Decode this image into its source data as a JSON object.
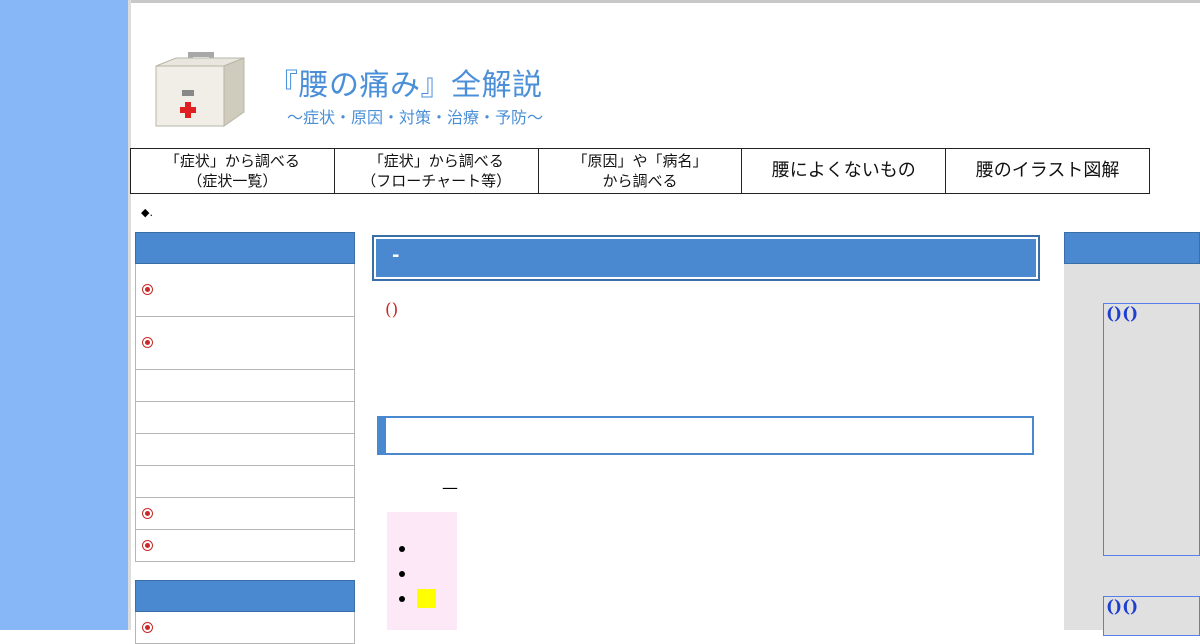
{
  "header": {
    "title": "『腰の痛み』全解説",
    "subtitle": "～症状・原因・対策・治療・予防～",
    "logo_icon": "first-aid-box-icon"
  },
  "nav": {
    "items": [
      {
        "line1": "「症状」から調べる",
        "line2": "（症状一覧）"
      },
      {
        "line1": "「症状」から調べる",
        "line2": "（フローチャート等）"
      },
      {
        "line1": "「原因」や「病名」",
        "line2": "から調べる"
      },
      {
        "line1": "腰によくないもの",
        "line2": ""
      },
      {
        "line1": "腰のイラスト図解",
        "line2": ""
      }
    ]
  },
  "breadcrumb": {
    "marker": "◆."
  },
  "main": {
    "title_text": "-",
    "red_text": "()",
    "dash_text": "—"
  },
  "right": {
    "box1_text": "()()",
    "box2_text": "()()"
  },
  "colors": {
    "accent": "#4a88cf",
    "sidebar_bg": "#87b7f6",
    "bullet": "#c62a2a",
    "pink": "#fde8f7",
    "highlight": "#ffff00"
  }
}
